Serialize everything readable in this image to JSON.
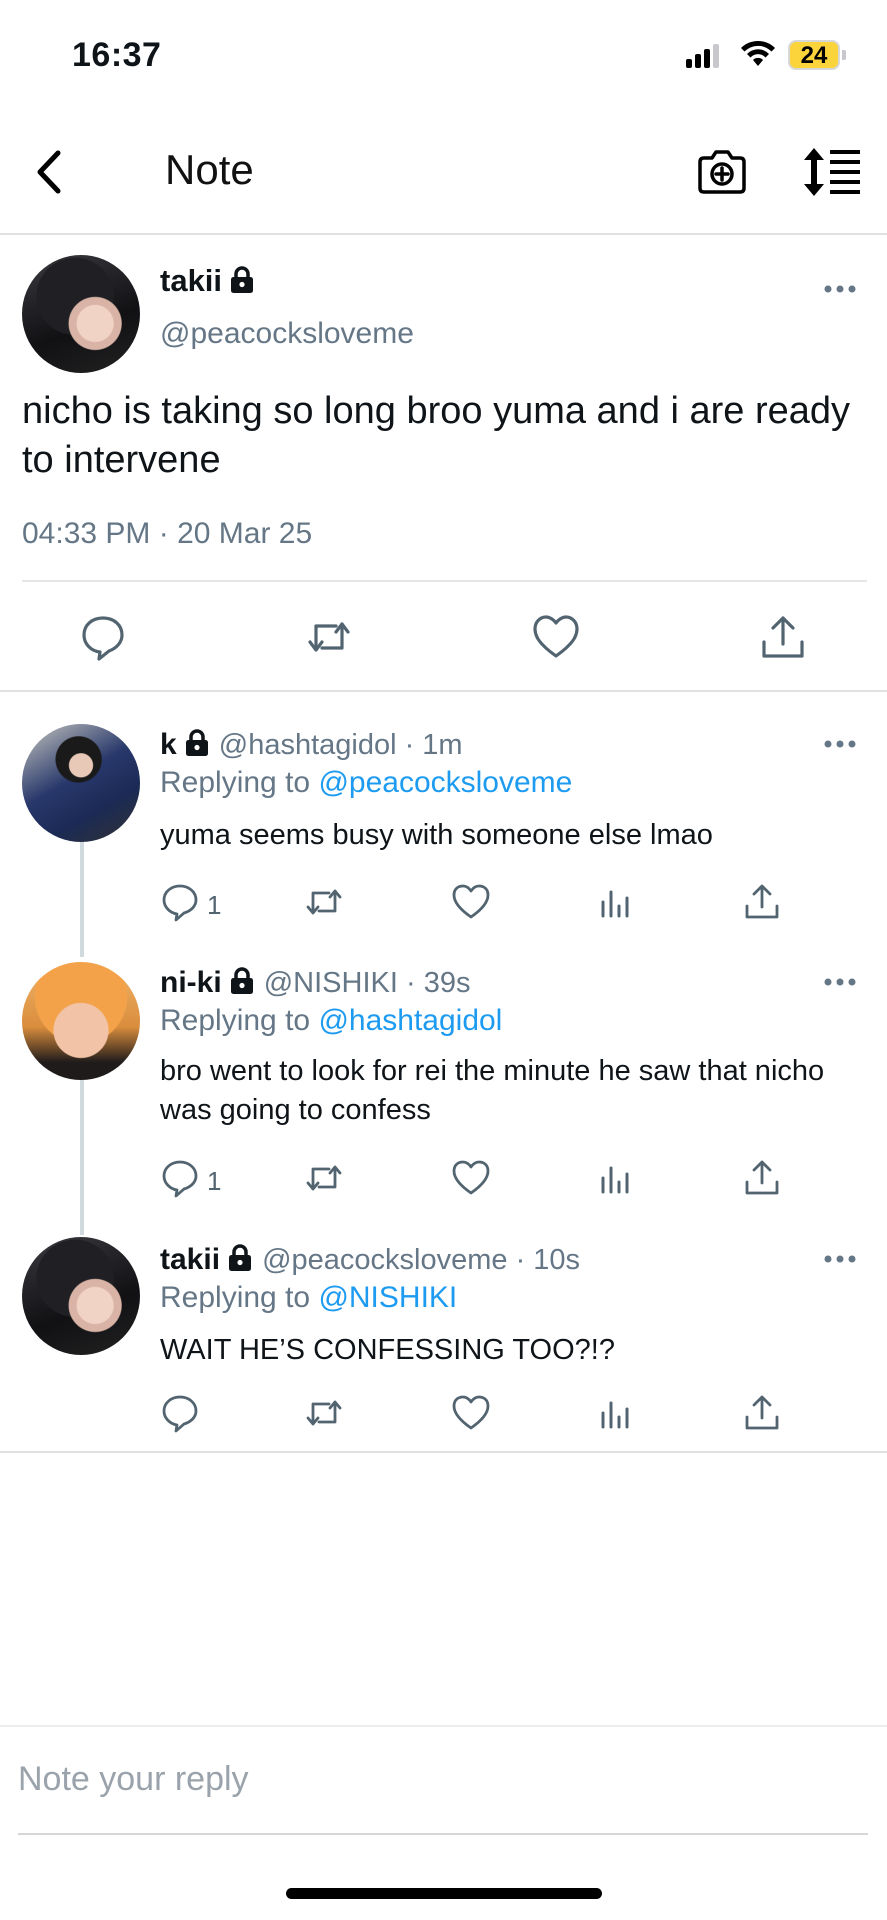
{
  "status_bar": {
    "time": "16:37",
    "battery": "24",
    "battery_color": "#fbd33a"
  },
  "header": {
    "title": "Note",
    "back_icon": "chevron-left-icon",
    "camera_icon": "camera-plus-icon",
    "sort_icon": "sort-list-icon"
  },
  "main_note": {
    "name": "takii",
    "handle": "@peacocksloveme",
    "text": "nicho is taking so long broo yuma and i are ready to intervene",
    "timestamp": "04:33 PM · 20 Mar 25",
    "actions": [
      "reply-icon",
      "repost-icon",
      "like-icon",
      "share-icon"
    ]
  },
  "replies": [
    {
      "name": "k",
      "meta": "@hashtagidol · 1m",
      "replying_label": "Replying to ",
      "replying_to": "@peacocksloveme",
      "text": "yuma seems busy with someone else lmao",
      "reply_count": "1"
    },
    {
      "name": "ni-ki",
      "meta": "@NISHIKI · 39s",
      "replying_label": "Replying to ",
      "replying_to": "@hashtagidol",
      "text": "bro went to look for rei the minute he saw that nicho was going to confess",
      "reply_count": "1"
    },
    {
      "name": "takii",
      "meta": "@peacocksloveme · 10s",
      "replying_label": "Replying to ",
      "replying_to": "@NISHIKI",
      "text": "WAIT HE’S CONFESSING TOO?!?",
      "reply_count": ""
    }
  ],
  "compose": {
    "placeholder": "Note your reply"
  },
  "colors": {
    "accent": "#1d9bf0",
    "secondary_text": "#657786"
  }
}
